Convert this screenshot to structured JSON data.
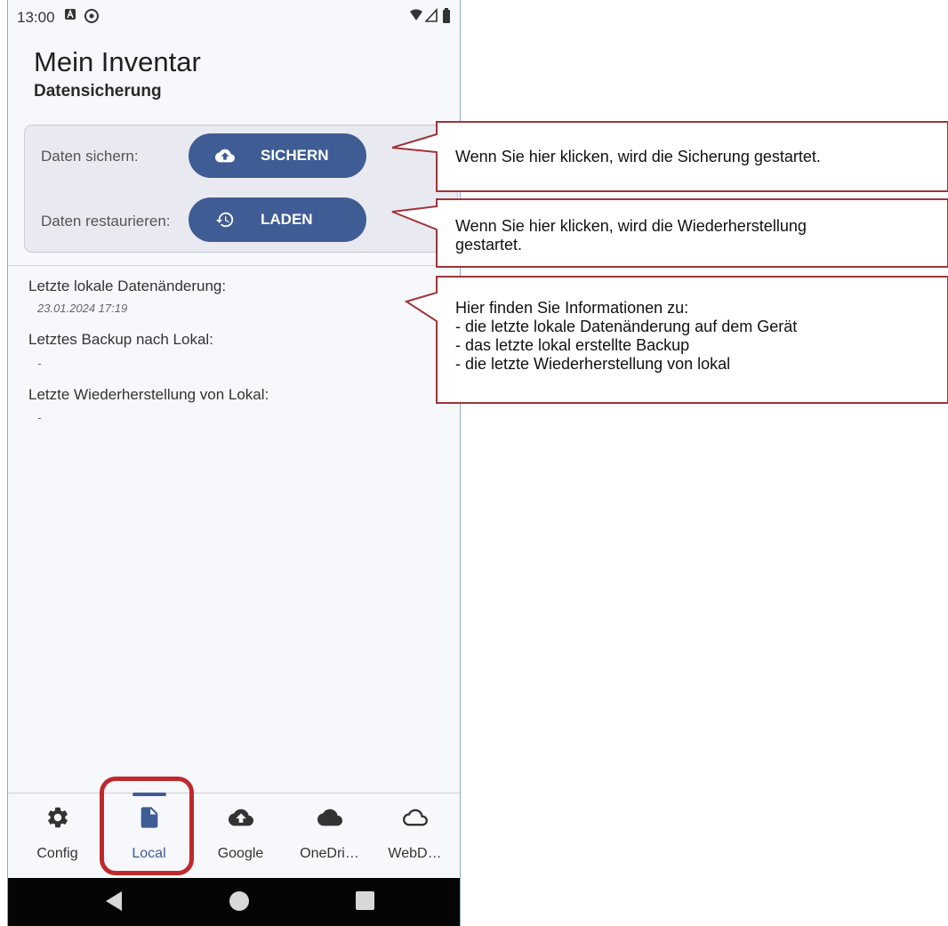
{
  "status_bar": {
    "time": "13:00",
    "icons": [
      "notification-a-icon",
      "sync-icon",
      "wifi-icon",
      "signal-icon",
      "battery-icon"
    ]
  },
  "app": {
    "title": "Mein Inventar",
    "subtitle": "Datensicherung"
  },
  "backup_card": {
    "save_label": "Daten sichern:",
    "save_button": "SICHERN",
    "restore_label": "Daten restaurieren:",
    "restore_button": "LADEN"
  },
  "info": [
    {
      "label": "Letzte lokale Datenänderung:",
      "value": "23.01.2024 17:19"
    },
    {
      "label": "Letztes Backup nach Lokal:",
      "value": "-"
    },
    {
      "label": "Letzte Wiederherstellung von Lokal:",
      "value": "-"
    }
  ],
  "bottom_nav": [
    {
      "label": "Config",
      "icon": "gear-icon",
      "active": false
    },
    {
      "label": "Local",
      "icon": "file-icon",
      "active": true
    },
    {
      "label": "Google",
      "icon": "cloud-upload-icon",
      "active": false
    },
    {
      "label": "OneDri…",
      "icon": "cloud-filled-icon",
      "active": false
    },
    {
      "label": "WebD…",
      "icon": "cloud-outline-icon",
      "active": false
    }
  ],
  "system_nav": [
    "back-icon",
    "home-icon",
    "recents-icon"
  ],
  "callouts": [
    "Wenn Sie hier klicken, wird die Sicherung gestartet.",
    "Wenn Sie hier klicken, wird die Wiederherstellung\ngestartet.",
    "Hier finden Sie Informationen zu:\n- die letzte lokale Datenänderung auf dem Gerät\n- das letzte lokal erstellte Backup\n- die letzte Wiederherstellung von lokal"
  ],
  "colors": {
    "primary": "#3f5c94",
    "callout_border": "#a0343a",
    "highlight": "#c0282d",
    "system_nav": "#050505"
  }
}
